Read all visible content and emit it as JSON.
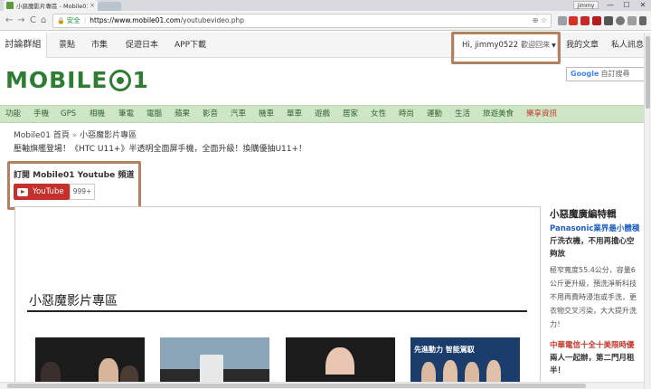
{
  "browser": {
    "tab_title": "小惡魔影片專區 - Mobile01",
    "tab_close": "×",
    "window_user": "jimmy",
    "win_min": "—",
    "win_max": "☐",
    "win_close": "✕",
    "back": "←",
    "forward": "→",
    "reload": "C",
    "home": "⌂",
    "lock_glyph": "🔒",
    "secure_label": "安全",
    "url_host": "https://www.mobile01.com",
    "url_path": "/youtubevideo.php",
    "zoom_icon": "⊕",
    "star_icon": "☆"
  },
  "site_nav": {
    "items": [
      "討論群組",
      "景點",
      "市集",
      "促遊日本",
      "APP下載"
    ],
    "user_greeting": "Hi, jimmy0522",
    "user_welcome": "歡迎回來",
    "caret": "▼",
    "my_posts": "我的文章",
    "messages": "私人訊息"
  },
  "logo": {
    "text": "MOBILE",
    "number": "1"
  },
  "search": {
    "brand": "Google",
    "label": "自訂搜尋"
  },
  "categories": {
    "items": [
      "功能",
      "手機",
      "GPS",
      "相機",
      "筆電",
      "電腦",
      "蘋果",
      "影音",
      "汽車",
      "機車",
      "單車",
      "遊戲",
      "居家",
      "女性",
      "時尚",
      "運動",
      "生活",
      "旅遊美食"
    ],
    "hot": "樂享資訊"
  },
  "breadcrumb": {
    "home": "Mobile01 首頁",
    "arrow": "»",
    "current": "小惡魔影片專區"
  },
  "headline": "壓軸旗艦登場！《HTC U11+》半透明全面屏手機，全面升級！換購優抽U11+！",
  "subscribe": {
    "label": "訂閱 Mobile01 Youtube 頻道",
    "button": "YouTube",
    "count": "999+"
  },
  "video_section": {
    "title": "小惡魔影片專區",
    "thumbnails": [
      {
        "caption": ""
      },
      {
        "caption": ""
      },
      {
        "caption": ""
      },
      {
        "caption": "先進動力 智能駕馭"
      }
    ]
  },
  "sidebar": {
    "title": "小惡魔廣編特輯",
    "item1_title": "Panasonic業界最小體積",
    "item1_line2": "斤洗衣機，不用再擔心空",
    "item1_line3": "夠放",
    "item1_desc": [
      "極窄寬度55.4公分，容量6",
      "公斤更升級，預洗淨新科技",
      "不用再費時浸泡或手洗，更",
      "衣物交叉污染，大大提升洗",
      "力！"
    ],
    "item2_title": "中華電信十全十美限時優",
    "item2_line2": "兩人一起辦，第二門月租",
    "item2_line3": "半！"
  },
  "colors": {
    "site_green": "#2e7d32",
    "category_bg": "#cfe6c6",
    "youtube_red": "#c4302b",
    "highlight_box": "#b5805e",
    "link_blue": "#1f5fbf"
  }
}
